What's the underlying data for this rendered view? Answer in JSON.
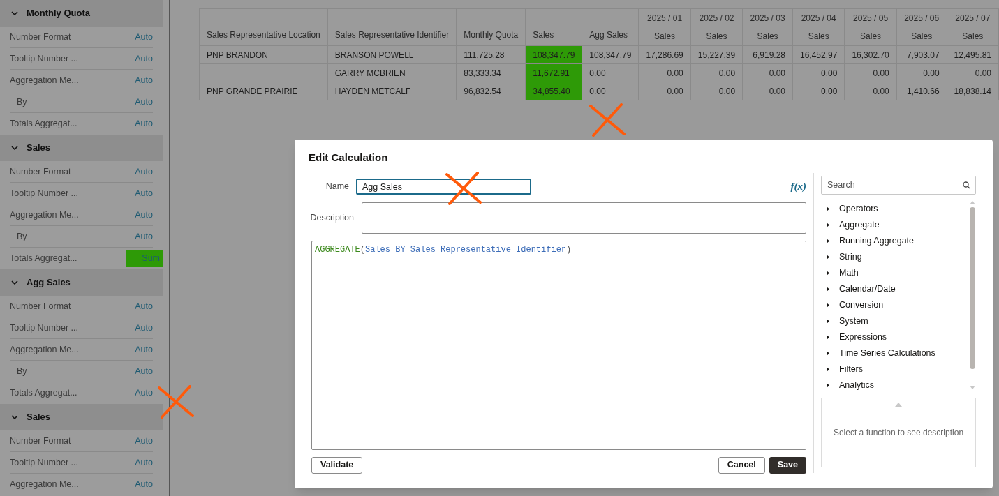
{
  "sidebar": {
    "sections": [
      {
        "title": "Monthly Quota",
        "expanded": true,
        "properties": [
          {
            "label": "Number Format",
            "value": "Auto",
            "kind": "main",
            "highlighted": false
          },
          {
            "label": "Tooltip Number ...",
            "value": "Auto",
            "kind": "main",
            "highlighted": false
          },
          {
            "label": "Aggregation Me...",
            "value": "Auto",
            "kind": "main",
            "highlighted": false
          },
          {
            "label": "By",
            "value": "Auto",
            "kind": "sub",
            "highlighted": false
          },
          {
            "label": "Totals Aggregat...",
            "value": "Auto",
            "kind": "main",
            "highlighted": false
          }
        ]
      },
      {
        "title": "Sales",
        "expanded": true,
        "properties": [
          {
            "label": "Number Format",
            "value": "Auto",
            "kind": "main",
            "highlighted": false
          },
          {
            "label": "Tooltip Number ...",
            "value": "Auto",
            "kind": "main",
            "highlighted": false
          },
          {
            "label": "Aggregation Me...",
            "value": "Auto",
            "kind": "main",
            "highlighted": false
          },
          {
            "label": "By",
            "value": "Auto",
            "kind": "sub",
            "highlighted": false
          },
          {
            "label": "Totals Aggregat...",
            "value": "Sum",
            "kind": "main",
            "highlighted": true
          }
        ]
      },
      {
        "title": "Agg Sales",
        "expanded": true,
        "properties": [
          {
            "label": "Number Format",
            "value": "Auto",
            "kind": "main",
            "highlighted": false
          },
          {
            "label": "Tooltip Number ...",
            "value": "Auto",
            "kind": "main",
            "highlighted": false
          },
          {
            "label": "Aggregation Me...",
            "value": "Auto",
            "kind": "main",
            "highlighted": false
          },
          {
            "label": "By",
            "value": "Auto",
            "kind": "sub",
            "highlighted": false
          },
          {
            "label": "Totals Aggregat...",
            "value": "Auto",
            "kind": "main",
            "highlighted": false
          }
        ]
      },
      {
        "title": "Sales",
        "expanded": true,
        "properties": [
          {
            "label": "Number Format",
            "value": "Auto",
            "kind": "main",
            "highlighted": false
          },
          {
            "label": "Tooltip Number ...",
            "value": "Auto",
            "kind": "main",
            "highlighted": false
          },
          {
            "label": "Aggregation Me...",
            "value": "Auto",
            "kind": "main",
            "highlighted": false
          }
        ]
      }
    ]
  },
  "table": {
    "columns": [
      "Sales Representative Location",
      "Sales Representative Identifier",
      "Monthly Quota",
      "Sales",
      "Agg Sales"
    ],
    "months": [
      {
        "period": "2025 / 01",
        "measure": "Sales"
      },
      {
        "period": "2025 / 02",
        "measure": "Sales"
      },
      {
        "period": "2025 / 03",
        "measure": "Sales"
      },
      {
        "period": "2025 / 04",
        "measure": "Sales"
      },
      {
        "period": "2025 / 05",
        "measure": "Sales"
      },
      {
        "period": "2025 / 06",
        "measure": "Sales"
      },
      {
        "period": "2025 / 07",
        "measure": "Sales"
      }
    ],
    "rows": [
      {
        "location": "PNP BRANDON",
        "identifier": "BRANSON POWELL",
        "quota": "111,725.28",
        "sales": "108,347.79",
        "sales_highlighted": true,
        "agg_sales": "108,347.79",
        "monthly": [
          "17,286.69",
          "15,227.39",
          "6,919.28",
          "16,452.97",
          "16,302.70",
          "7,903.07",
          "12,495.81"
        ]
      },
      {
        "identifier": "GARRY MCBRIEN",
        "quota": "83,333.34",
        "sales": "11,672.91",
        "sales_highlighted": true,
        "agg_sales": "0.00",
        "monthly": [
          "0.00",
          "0.00",
          "0.00",
          "0.00",
          "0.00",
          "0.00",
          "0.00"
        ]
      },
      {
        "location": "PNP GRANDE PRAIRIE",
        "identifier": "HAYDEN METCALF",
        "quota": "96,832.54",
        "sales": "34,855.40",
        "sales_highlighted": true,
        "agg_sales": "0.00",
        "monthly": [
          "0.00",
          "0.00",
          "0.00",
          "0.00",
          "0.00",
          "1,410.66",
          "18,838.14"
        ]
      }
    ]
  },
  "dialog": {
    "title": "Edit Calculation",
    "name_label": "Name",
    "name_value": "Agg Sales",
    "description_label": "Description",
    "formula_button": "f(x)",
    "formula": [
      {
        "text": "AGGREGATE",
        "kind": "function"
      },
      {
        "text": "(",
        "kind": "punct"
      },
      {
        "text": "Sales BY Sales Representative Identifier",
        "kind": "column"
      },
      {
        "text": ")",
        "kind": "punct"
      }
    ],
    "validate": "Validate",
    "cancel": "Cancel",
    "save": "Save",
    "search": {
      "placeholder": "Search"
    },
    "categories": [
      "Operators",
      "Aggregate",
      "Running Aggregate",
      "String",
      "Math",
      "Calendar/Date",
      "Conversion",
      "System",
      "Expressions",
      "Time Series Calculations",
      "Filters",
      "Analytics"
    ],
    "description_hint": "Select a function to see description"
  }
}
